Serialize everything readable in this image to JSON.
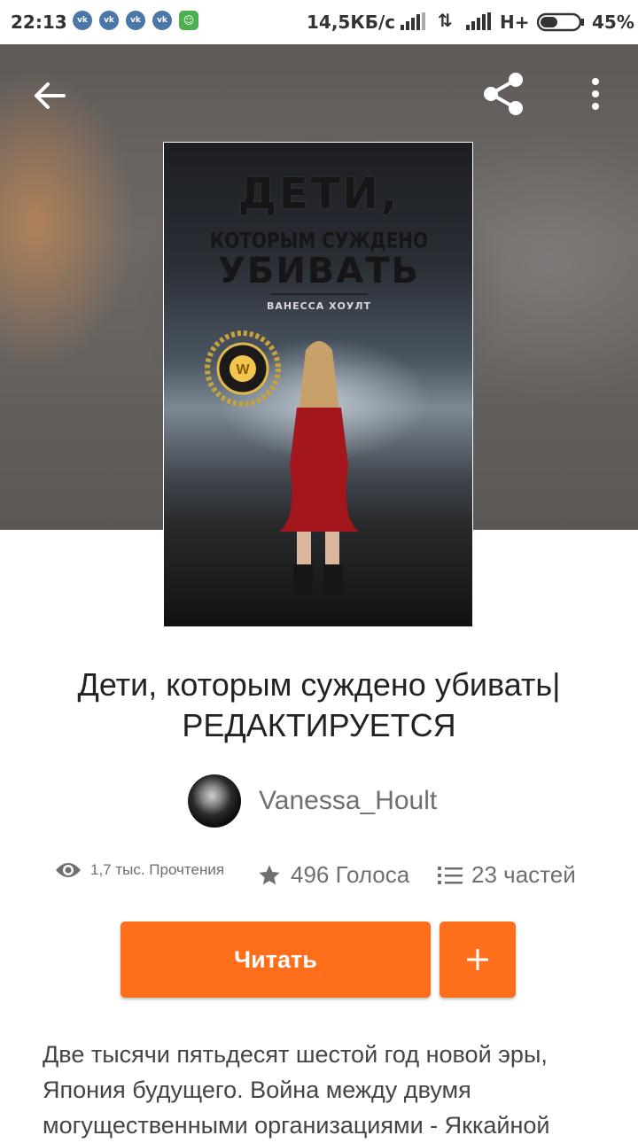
{
  "status_bar": {
    "time": "22:13",
    "notifications": [
      "vk-icon",
      "vk-icon",
      "vk-icon",
      "vk-icon",
      "game-icon"
    ],
    "speed": "14,5КБ/с",
    "network": "H+",
    "battery_percent": "45%",
    "battery_level": 0.45
  },
  "header": {
    "back_icon": "arrow-left-icon",
    "share_icon": "share-icon",
    "menu_icon": "more-vertical-icon"
  },
  "cover": {
    "title_line1": "ДЕТИ,",
    "title_line2": "КОТОРЫМ СУЖДЕНО",
    "title_line3": "УБИВАТЬ",
    "author": "ВАНЕССА ХОУЛТ",
    "badge_letter": "W"
  },
  "book": {
    "title": "Дети, которым суждено убивать| РЕДАКТИРУЕТСЯ"
  },
  "author": {
    "name": "Vanessa_Hoult"
  },
  "stats": {
    "reads": "1,7 тыс. Прочтения",
    "votes": "496 Голоса",
    "parts": "23 частей"
  },
  "actions": {
    "read_label": "Читать",
    "add_icon": "plus-icon"
  },
  "description": "Две тысячи пятьдесят шестой год новой эры, Япония будущего. Война между двумя могущественными организациями - Яккайной",
  "colors": {
    "accent": "#ff6e1a",
    "text": "#222222",
    "muted": "#6f6f6f"
  }
}
